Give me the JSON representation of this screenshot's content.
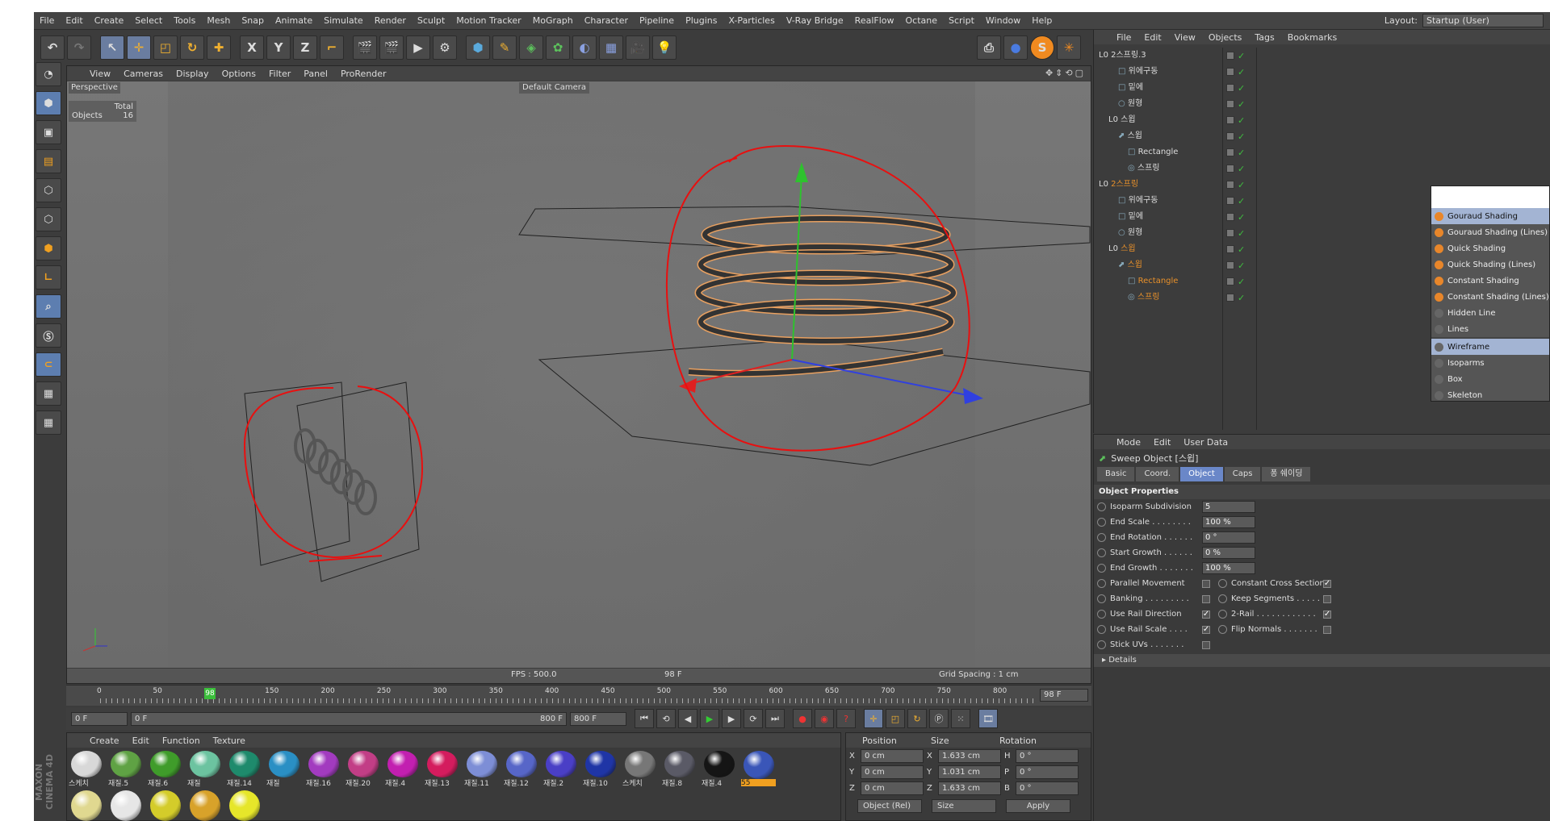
{
  "menubar": {
    "items": [
      "File",
      "Edit",
      "Create",
      "Select",
      "Tools",
      "Mesh",
      "Snap",
      "Animate",
      "Simulate",
      "Render",
      "Sculpt",
      "Motion Tracker",
      "MoGraph",
      "Character",
      "Pipeline",
      "Plugins",
      "X-Particles",
      "V-Ray Bridge",
      "RealFlow",
      "Octane",
      "Script",
      "Window",
      "Help"
    ],
    "layout_label": "Layout:",
    "layout_value": "Startup (User)"
  },
  "toolbar": {
    "axis_labels": [
      "X",
      "Y",
      "Z"
    ]
  },
  "viewport": {
    "menu": [
      "View",
      "Cameras",
      "Display",
      "Options",
      "Filter",
      "Panel",
      "ProRender"
    ],
    "label": "Perspective",
    "camera": "Default Camera",
    "hud_header": "Total",
    "hud_row_label": "Objects",
    "hud_row_value": "16",
    "fps": "FPS : 500.0",
    "frame": "98 F",
    "grid": "Grid Spacing : 1 cm"
  },
  "timeline": {
    "ticks": [
      "0",
      "50",
      "98",
      "150",
      "200",
      "250",
      "300",
      "350",
      "400",
      "450",
      "500",
      "550",
      "600",
      "650",
      "700",
      "750",
      "800"
    ],
    "current": "98 F",
    "playhead": "98"
  },
  "transport": {
    "start": "0 F",
    "slider_start": "0 F",
    "slider_end": "800 F",
    "end": "800 F"
  },
  "materials": {
    "menu": [
      "Create",
      "Edit",
      "Function",
      "Texture"
    ],
    "items": [
      {
        "name": "스케치 ",
        "color": "#d8d8d8"
      },
      {
        "name": "재질.5",
        "color": "#5fa244"
      },
      {
        "name": "재질.6",
        "color": "#3f9c2a"
      },
      {
        "name": "재질",
        "color": "#6cc3a0"
      },
      {
        "name": "재질.14",
        "color": "#1e8a6c"
      },
      {
        "name": "재질",
        "color": "#2a8fc4"
      },
      {
        "name": "재질.16",
        "color": "#a23bbf"
      },
      {
        "name": "재질.20",
        "color": "#c23e86"
      },
      {
        "name": "재질.4",
        "color": "#c21fb0"
      },
      {
        "name": "재질.13",
        "color": "#d41c5e"
      },
      {
        "name": "재질.11",
        "color": "#7d8ed6"
      },
      {
        "name": "재질.12",
        "color": "#5766c8"
      },
      {
        "name": "재질.2",
        "color": "#4a3fc6"
      },
      {
        "name": "재질.10",
        "color": "#1f35a6"
      },
      {
        "name": "스케치 ",
        "color": "#777777"
      },
      {
        "name": "재질.8",
        "color": "#5a5a66"
      },
      {
        "name": "재질.4",
        "color": "#151515"
      },
      {
        "name": "55",
        "color": "#3a56b8"
      },
      {
        "name": "",
        "color": "#e0d890"
      },
      {
        "name": "",
        "color": "#e6e6e6"
      },
      {
        "name": "",
        "color": "#d4cc2a"
      },
      {
        "name": "",
        "color": "#d8a22a"
      },
      {
        "name": "",
        "color": "#e6e62a"
      }
    ]
  },
  "coords": {
    "headers": [
      "Position",
      "Size",
      "Rotation"
    ],
    "rows": [
      {
        "axis": "X",
        "pos": "0 cm",
        "saxis": "X",
        "size": "1.633 cm",
        "raxis": "H",
        "rot": "0 °"
      },
      {
        "axis": "Y",
        "pos": "0 cm",
        "saxis": "Y",
        "size": "1.031 cm",
        "raxis": "P",
        "rot": "0 °"
      },
      {
        "axis": "Z",
        "pos": "0 cm",
        "saxis": "Z",
        "size": "1.633 cm",
        "raxis": "B",
        "rot": "0 °"
      }
    ],
    "mode": "Object (Rel)",
    "size_mode": "Size",
    "apply": "Apply"
  },
  "objects": {
    "menu": [
      "File",
      "Edit",
      "View",
      "Objects",
      "Tags",
      "Bookmarks"
    ],
    "rows": [
      {
        "name": "2스프링.3",
        "indent": 0,
        "icon": "L0",
        "orange": false
      },
      {
        "name": "위에구동",
        "indent": 2,
        "icon": "□",
        "orange": false
      },
      {
        "name": "밑에",
        "indent": 2,
        "icon": "□",
        "orange": false
      },
      {
        "name": "원형",
        "indent": 2,
        "icon": "○",
        "orange": false
      },
      {
        "name": "스윕",
        "indent": 1,
        "icon": "L0",
        "orange": false
      },
      {
        "name": "스윕",
        "indent": 2,
        "icon": "⬈",
        "orange": false
      },
      {
        "name": "Rectangle",
        "indent": 3,
        "icon": "□",
        "orange": false
      },
      {
        "name": "스프링",
        "indent": 3,
        "icon": "◎",
        "orange": false
      },
      {
        "name": "2스프링",
        "indent": 0,
        "icon": "L0",
        "orange": true
      },
      {
        "name": "위에구동",
        "indent": 2,
        "icon": "□",
        "orange": false
      },
      {
        "name": "밑에",
        "indent": 2,
        "icon": "□",
        "orange": false
      },
      {
        "name": "원형",
        "indent": 2,
        "icon": "○",
        "orange": false
      },
      {
        "name": "스윕",
        "indent": 1,
        "icon": "L0",
        "orange": true
      },
      {
        "name": "스윕",
        "indent": 2,
        "icon": "⬈",
        "orange": true
      },
      {
        "name": "Rectangle",
        "indent": 3,
        "icon": "□",
        "orange": true
      },
      {
        "name": "스프링",
        "indent": 3,
        "icon": "◎",
        "orange": true
      }
    ]
  },
  "shading_menu": {
    "items": [
      {
        "label": "Gouraud Shading",
        "dot": "orange",
        "hl": true
      },
      {
        "label": "Gouraud Shading (Lines)",
        "dot": "orange",
        "hl": false
      },
      {
        "label": "Quick Shading",
        "dot": "orange",
        "hl": false
      },
      {
        "label": "Quick Shading (Lines)",
        "dot": "orange",
        "hl": false
      },
      {
        "label": "Constant Shading",
        "dot": "orange",
        "hl": false
      },
      {
        "label": "Constant Shading (Lines)",
        "dot": "orange",
        "hl": false
      },
      {
        "label": "Hidden Line",
        "dot": "gray",
        "hl": false
      },
      {
        "label": "Lines",
        "dot": "gray",
        "hl": false
      },
      {
        "label": "Wireframe",
        "dot": "gray",
        "hl": true
      },
      {
        "label": "Isoparms",
        "dot": "gray",
        "hl": false
      },
      {
        "label": "Box",
        "dot": "gray",
        "hl": false
      },
      {
        "label": "Skeleton",
        "dot": "gray",
        "hl": false
      }
    ]
  },
  "attributes": {
    "menu": [
      "Mode",
      "Edit",
      "User Data"
    ],
    "title": "Sweep Object [스윕]",
    "tabs": [
      "Basic",
      "Coord.",
      "Object",
      "Caps",
      "퐁 쉐이딩"
    ],
    "active_tab": "Object",
    "section": "Object Properties",
    "fields": [
      {
        "label": "Isoparm Subdivision",
        "value": "5"
      },
      {
        "label": "End Scale . . . . . . . .",
        "value": "100 %"
      },
      {
        "label": "End Rotation . . . . . .",
        "value": "0 °"
      },
      {
        "label": "Start Growth . . . . . .",
        "value": "0 %"
      },
      {
        "label": "End Growth . . . . . . .",
        "value": "100 %"
      }
    ],
    "checks_left": [
      {
        "label": "Parallel Movement",
        "checked": false
      },
      {
        "label": "Banking . . . . . . . . .",
        "checked": false
      },
      {
        "label": "Use Rail Direction",
        "checked": true
      },
      {
        "label": "Use Rail Scale . . . .",
        "checked": true
      },
      {
        "label": "Stick UVs . . . . . . .",
        "checked": false
      }
    ],
    "checks_right": [
      {
        "label": "Constant Cross Section",
        "checked": true
      },
      {
        "label": "Keep Segments . . . . .",
        "checked": false
      },
      {
        "label": "2-Rail . . . . . . . . . . . .",
        "checked": true
      },
      {
        "label": "Flip Normals . . . . . . .",
        "checked": false
      }
    ],
    "details": "Details"
  },
  "app": {
    "brand": "MAXON CINEMA 4D"
  }
}
